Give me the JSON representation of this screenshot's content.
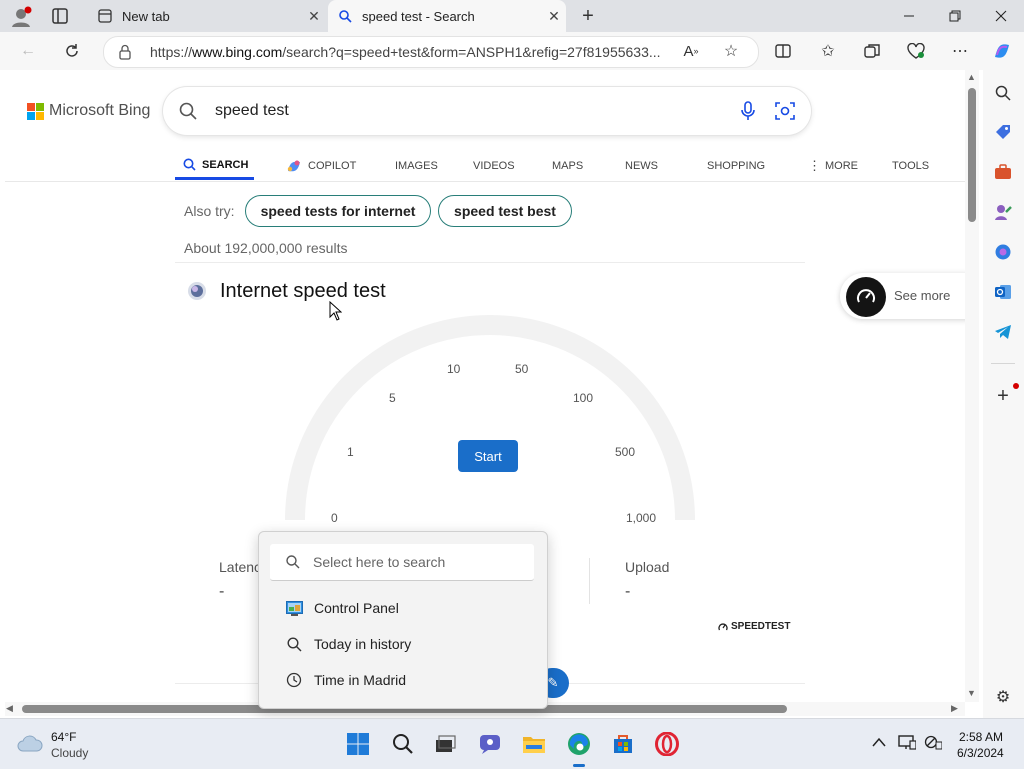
{
  "browser": {
    "tabs": [
      {
        "label": "New tab"
      },
      {
        "label": "speed test - Search"
      }
    ],
    "url_prefix": "https://",
    "url_domain": "www.bing.com",
    "url_rest": "/search?q=speed+test&form=ANSPH1&refig=27f81955633..."
  },
  "bing": {
    "logo_text": "Microsoft Bing",
    "query": "speed test",
    "nav": [
      "SEARCH",
      "COPILOT",
      "IMAGES",
      "VIDEOS",
      "MAPS",
      "NEWS",
      "SHOPPING",
      "MORE",
      "TOOLS"
    ],
    "also_try_label": "Also try:",
    "also_try": [
      "speed tests for internet",
      "speed test best"
    ],
    "results_count": "About 192,000,000 results",
    "speedtest": {
      "title": "Internet speed test",
      "ticks": [
        "0",
        "1",
        "5",
        "10",
        "50",
        "100",
        "500",
        "1,000"
      ],
      "start_label": "Start",
      "latency_label": "Latenc",
      "latency_value": "-",
      "upload_label": "Upload",
      "upload_value": "-",
      "brand": "SPEEDTEST",
      "see_more": "See more"
    }
  },
  "popup": {
    "placeholder": "Select here to search",
    "items": [
      "Control Panel",
      "Today in history",
      "Time in Madrid"
    ]
  },
  "taskbar": {
    "weather_temp": "64°F",
    "weather_desc": "Cloudy",
    "time": "2:58 AM",
    "date": "6/3/2024"
  },
  "colors": {
    "accent": "#174ae4",
    "pill_border": "#287e79",
    "start_button": "#1a6ec9"
  }
}
